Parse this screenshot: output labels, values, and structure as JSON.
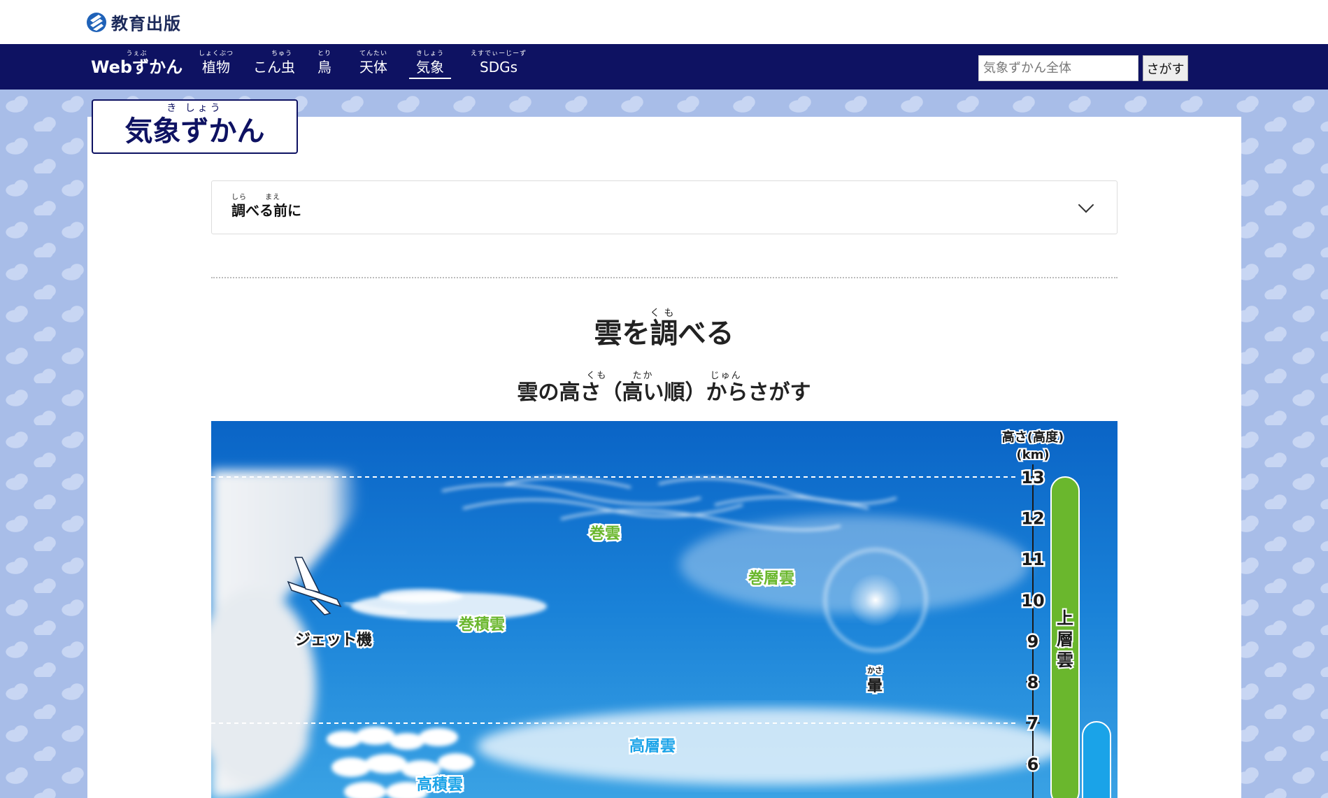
{
  "brand": {
    "name": "教育出版"
  },
  "nav": {
    "items": [
      {
        "ruby": "うぇぶ",
        "label": "Webずかん"
      },
      {
        "ruby": "しょくぶつ",
        "label": "植物"
      },
      {
        "ruby": "ちゅう",
        "label": "こん虫"
      },
      {
        "ruby": "とり",
        "label": "鳥"
      },
      {
        "ruby": "てんたい",
        "label": "天体"
      },
      {
        "ruby": "きしょう",
        "label": "気象"
      },
      {
        "ruby": "えすでぃーじーず",
        "label": "SDGs"
      }
    ],
    "search_placeholder": "気象ずかん全体",
    "search_button": "さがす"
  },
  "zukan": {
    "ruby": "き しょう",
    "title": "気象ずかん"
  },
  "accordion": {
    "ruby": "しら　　 まえ",
    "label": "調べる前に"
  },
  "heading": {
    "ruby": "くも",
    "title": "雲を調べる"
  },
  "subheading": {
    "ruby": "くも　　 たか　　　　　 じゅん",
    "title": "雲の高さ（高い順）からさがす"
  },
  "diagram": {
    "axis_title_1": "高さ(高度)",
    "axis_title_2": "(km)",
    "ticks": [
      "13",
      "12",
      "11",
      "10",
      "9",
      "8",
      "7",
      "6"
    ],
    "band_label": "上層雲",
    "labels": {
      "kenun": "巻雲",
      "kensouun": "巻層雲",
      "kensekiun": "巻積雲",
      "jet": "ジェット機",
      "kasa_ruby": "かさ",
      "kasa": "暈",
      "kousouun": "高層雲",
      "kousekiun": "高積雲"
    },
    "colors": {
      "upper": "#6ab72d",
      "middle": "#1aa3e8"
    }
  }
}
